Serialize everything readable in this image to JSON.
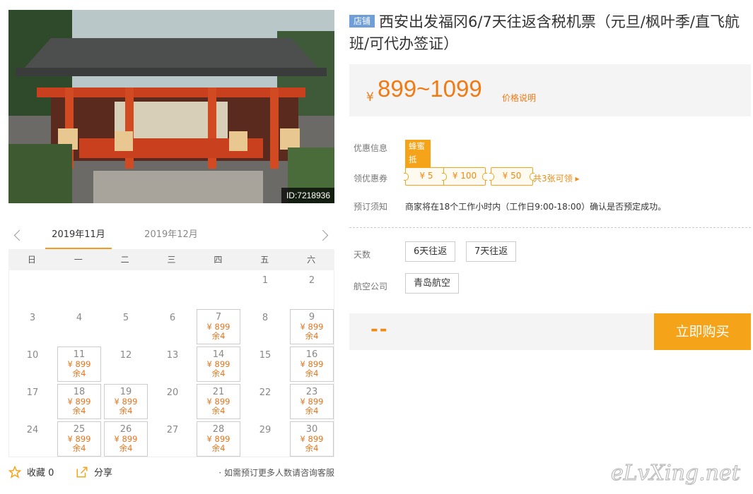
{
  "photo": {
    "id_label": "ID:7218936"
  },
  "calendar": {
    "months": [
      "2019年11月",
      "2019年12月"
    ],
    "weekdays": [
      "日",
      "一",
      "二",
      "三",
      "四",
      "五",
      "六"
    ],
    "days": [
      {
        "day": "1",
        "col": 5,
        "row": 0
      },
      {
        "day": "2",
        "col": 6,
        "row": 0
      },
      {
        "day": "3",
        "col": 0,
        "row": 1
      },
      {
        "day": "4",
        "col": 1,
        "row": 1
      },
      {
        "day": "5",
        "col": 2,
        "row": 1
      },
      {
        "day": "6",
        "col": 3,
        "row": 1
      },
      {
        "day": "7",
        "col": 4,
        "row": 1,
        "price": "¥ 899",
        "remain": "余4"
      },
      {
        "day": "8",
        "col": 5,
        "row": 1
      },
      {
        "day": "9",
        "col": 6,
        "row": 1,
        "price": "¥ 899",
        "remain": "余4"
      },
      {
        "day": "10",
        "col": 0,
        "row": 2
      },
      {
        "day": "11",
        "col": 1,
        "row": 2,
        "price": "¥ 899",
        "remain": "余4"
      },
      {
        "day": "12",
        "col": 2,
        "row": 2
      },
      {
        "day": "13",
        "col": 3,
        "row": 2
      },
      {
        "day": "14",
        "col": 4,
        "row": 2,
        "price": "¥ 899",
        "remain": "余4"
      },
      {
        "day": "15",
        "col": 5,
        "row": 2
      },
      {
        "day": "16",
        "col": 6,
        "row": 2,
        "price": "¥ 899",
        "remain": "余4"
      },
      {
        "day": "17",
        "col": 0,
        "row": 3
      },
      {
        "day": "18",
        "col": 1,
        "row": 3,
        "price": "¥ 899",
        "remain": "余4"
      },
      {
        "day": "19",
        "col": 2,
        "row": 3,
        "price": "¥ 899",
        "remain": "余4"
      },
      {
        "day": "20",
        "col": 3,
        "row": 3
      },
      {
        "day": "21",
        "col": 4,
        "row": 3,
        "price": "¥ 899",
        "remain": "余4"
      },
      {
        "day": "22",
        "col": 5,
        "row": 3
      },
      {
        "day": "23",
        "col": 6,
        "row": 3,
        "price": "¥ 899",
        "remain": "余4"
      },
      {
        "day": "24",
        "col": 0,
        "row": 4
      },
      {
        "day": "25",
        "col": 1,
        "row": 4,
        "price": "¥ 899",
        "remain": "余4"
      },
      {
        "day": "26",
        "col": 2,
        "row": 4,
        "price": "¥ 899",
        "remain": "余4"
      },
      {
        "day": "27",
        "col": 3,
        "row": 4
      },
      {
        "day": "28",
        "col": 4,
        "row": 4,
        "price": "¥ 899",
        "remain": "余4"
      },
      {
        "day": "29",
        "col": 5,
        "row": 4
      },
      {
        "day": "30",
        "col": 6,
        "row": 4,
        "price": "¥ 899",
        "remain": "余4"
      }
    ]
  },
  "footer": {
    "favorite_label": "收藏 0",
    "share_label": "分享",
    "note": "· 如需预订更多人数请咨询客服"
  },
  "product": {
    "badge": "店铺",
    "title": "西安出发福冈6/7天往返含税机票（元旦/枫叶季/直飞航班/可代办签证）",
    "price_currency": "¥",
    "price_range": "899~1099",
    "price_note": "价格说明"
  },
  "promo": {
    "label": "优惠信息",
    "tag": "蜂蜜抵10%"
  },
  "coupons": {
    "label": "领优惠券",
    "items": [
      "¥ 5",
      "¥ 100",
      "¥ 50"
    ],
    "more": "共3张可领 ▸"
  },
  "notice": {
    "label": "预订须知",
    "text": "商家将在18个工作小时内（工作日9:00-18:00）确认是否预定成功。"
  },
  "options": {
    "days_label": "天数",
    "days": [
      "6天往返",
      "7天往返"
    ],
    "airline_label": "航空公司",
    "airlines": [
      "青岛航空"
    ]
  },
  "buy": {
    "total": "--",
    "button": "立即购买"
  },
  "watermark": {
    "text": "eLvXing.net"
  },
  "colors": {
    "accent": "#f5a41a",
    "price": "#f07a14",
    "badge": "#6f9ed8"
  }
}
